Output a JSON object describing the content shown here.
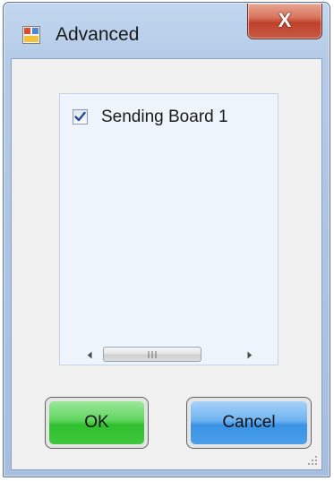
{
  "window": {
    "title": "Advanced",
    "close_glyph": "X",
    "app_icon": "app-window-icon",
    "close_icon": "close-icon"
  },
  "list": {
    "items": [
      {
        "label": "Sending Board 1",
        "checked": true
      }
    ],
    "scrollbar": {
      "left_icon": "scroll-left-arrow-icon",
      "right_icon": "scroll-right-arrow-icon"
    }
  },
  "buttons": {
    "ok_label": "OK",
    "cancel_label": "Cancel"
  },
  "colors": {
    "ok_button": "#3ec83c",
    "cancel_button": "#4a9fea",
    "close_button": "#c0412b",
    "frame": "#abc3e4"
  }
}
